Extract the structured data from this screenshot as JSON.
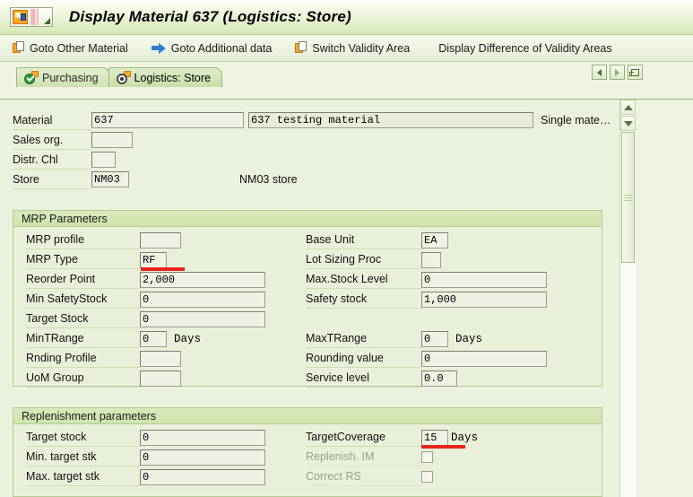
{
  "window": {
    "title": "Display Material 637 (Logistics: Store)",
    "system_icon": "sap-menu-icon"
  },
  "toolbar": {
    "buttons": [
      {
        "label": "Goto Other Material",
        "icon": "copy-document-icon"
      },
      {
        "label": "Goto Additional data",
        "icon": "blue-arrow-right-icon"
      },
      {
        "label": "Switch Validity Area",
        "icon": "copy-document-icon"
      },
      {
        "label": "Display Difference of Validity Areas",
        "icon": "none"
      }
    ]
  },
  "tabs": [
    {
      "label": "Purchasing",
      "icon": "green-check-icon",
      "active": false
    },
    {
      "label": "Logistics: Store",
      "icon": "radio-selected-icon",
      "active": true
    }
  ],
  "tab_nav": {
    "prev": "previous-tab-icon",
    "next": "next-tab-icon",
    "list": "tab-list-icon"
  },
  "header_fields": {
    "material": {
      "label": "Material",
      "value": "637",
      "description": "637 testing material",
      "note": "Single mate…"
    },
    "sales_org": {
      "label": "Sales org.",
      "value": ""
    },
    "distr_chl": {
      "label": "Distr. Chl",
      "value": ""
    },
    "store": {
      "label": "Store",
      "value": "NM03",
      "description": "NM03 store"
    }
  },
  "mrp_parameters": {
    "title": "MRP Parameters",
    "left": [
      {
        "label": "MRP profile",
        "value": "",
        "unit": ""
      },
      {
        "label": "MRP Type",
        "value": "RF",
        "unit": "",
        "highlighted": true
      },
      {
        "label": "Reorder Point",
        "value": "2,000",
        "unit": ""
      },
      {
        "label": "Min SafetyStock",
        "value": "0",
        "unit": ""
      },
      {
        "label": "Target Stock",
        "value": "0",
        "unit": ""
      },
      {
        "label": "MinTRange",
        "value": "0",
        "unit": "Days"
      },
      {
        "label": "Rnding Profile",
        "value": "",
        "unit": ""
      },
      {
        "label": "UoM Group",
        "value": "",
        "unit": ""
      }
    ],
    "right": [
      {
        "label": "Base Unit",
        "value": "EA",
        "unit": ""
      },
      {
        "label": "Lot Sizing Proc",
        "value": "",
        "unit": ""
      },
      {
        "label": "Max.Stock Level",
        "value": "0",
        "unit": ""
      },
      {
        "label": "Safety stock",
        "value": "1,000",
        "unit": ""
      },
      {
        "label": "MaxTRange",
        "value": "0",
        "unit": "Days"
      },
      {
        "label": "Rounding value",
        "value": "0",
        "unit": ""
      },
      {
        "label": "Service level",
        "value": "0.0",
        "unit": ""
      }
    ]
  },
  "replenishment_parameters": {
    "title": "Replenishment parameters",
    "left": [
      {
        "label": "Target stock",
        "value": "0"
      },
      {
        "label": "Min. target stk",
        "value": "0"
      },
      {
        "label": "Max. target stk",
        "value": "0"
      }
    ],
    "right": [
      {
        "label": "TargetCoverage",
        "value": "15",
        "unit": "Days",
        "highlighted": true
      },
      {
        "label": "Replenish. IM",
        "checkbox": true,
        "checked": false,
        "disabled": true
      },
      {
        "label": "Correct RS",
        "checkbox": true,
        "checked": false,
        "disabled": true
      }
    ]
  },
  "colors": {
    "accent": "#9cb87a",
    "highlight": "#e8251c",
    "panel_bg": "#eaf1dc",
    "group_header": "#d4e6b2"
  }
}
